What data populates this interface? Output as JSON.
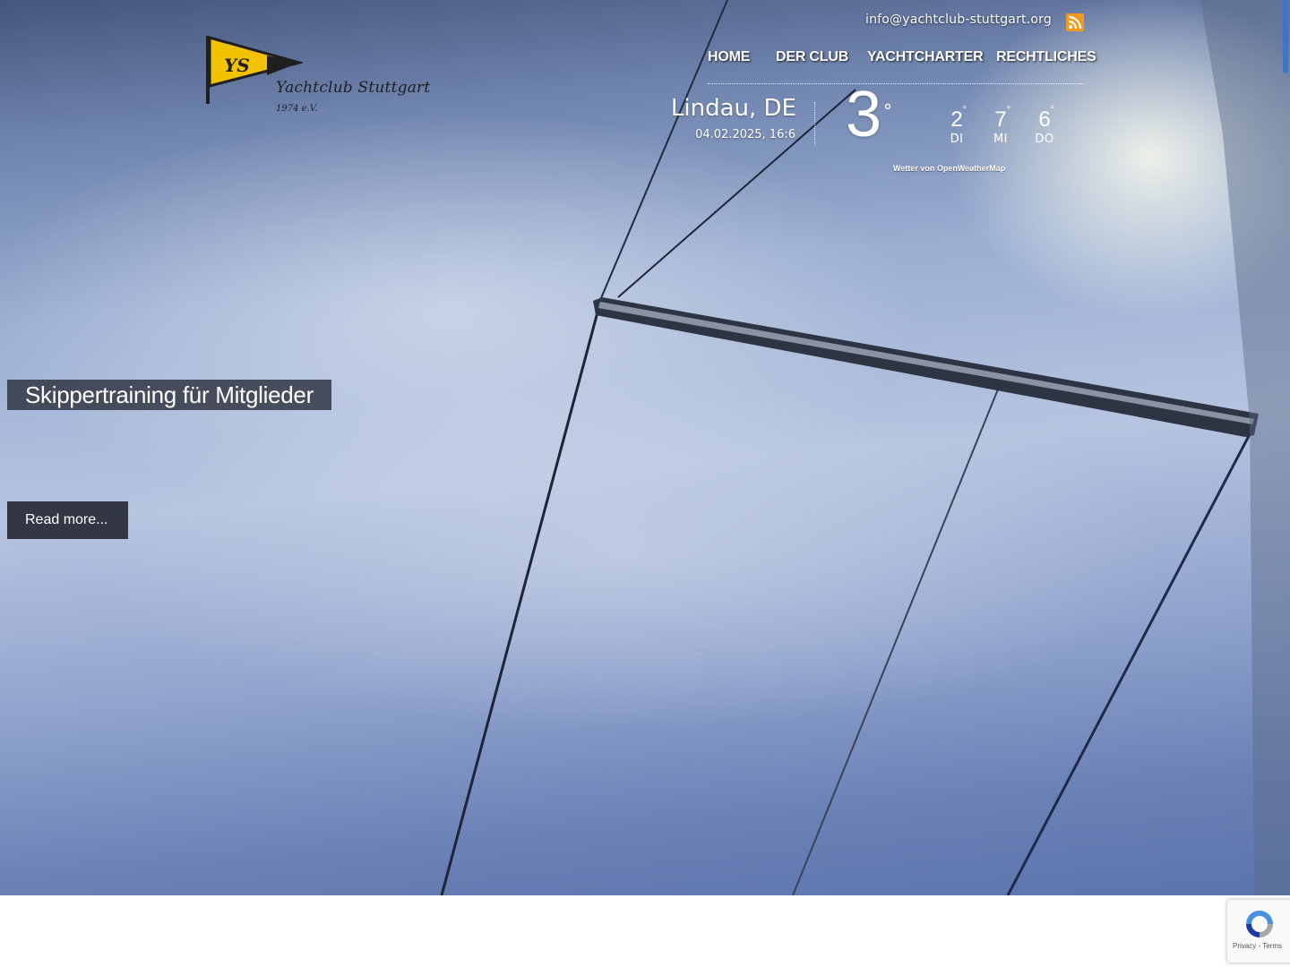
{
  "header": {
    "email": "info@yachtclub-stuttgart.org",
    "rss_icon": "rss-icon",
    "logo": {
      "name": "Yachtclub Stuttgart",
      "year": "1974 e.V.",
      "flag_mark": "YS",
      "colors": {
        "flag": "#f2c200",
        "ink": "#1f1f1f"
      }
    },
    "nav": [
      {
        "label": "Home"
      },
      {
        "label": "Der Club"
      },
      {
        "label": "Yachtcharter"
      },
      {
        "label": "Rechtliches"
      }
    ]
  },
  "weather": {
    "city": "Lindau, DE",
    "datetime": "04.02.2025, 16:6",
    "current_temp": "3",
    "unit": "°",
    "forecast": [
      {
        "temp": "2",
        "day": "DI"
      },
      {
        "temp": "7",
        "day": "MI"
      },
      {
        "temp": "6",
        "day": "DO"
      }
    ],
    "credit": "Wetter von OpenWeatherMap"
  },
  "slide": {
    "title": "Skippertraining für Mitglieder",
    "read_more": "Read more..."
  },
  "recaptcha": {
    "privacy": "Privacy",
    "separator": " - ",
    "terms": "Terms"
  },
  "colors": {
    "accent_scroll": "#3f74c9",
    "rss": "#f39a1c",
    "caption_bg": "#2d323e"
  }
}
